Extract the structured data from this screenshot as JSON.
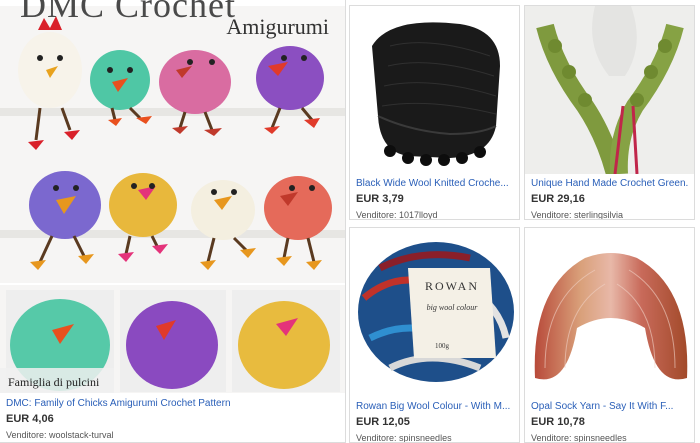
{
  "products": [
    {
      "title": "DMC: Family of Chicks Amigurumi Crochet Pattern",
      "price": "EUR 4,06",
      "seller": "Venditore: woolstack-turval",
      "image_texts": {
        "brand": "DMC Crochet",
        "subtitle": "Amigurumi",
        "caption": "Famiglia di pulcini"
      }
    },
    {
      "title": "Black Wide Wool Knitted Croche...",
      "price": "EUR 3,79",
      "seller": "Venditore: 1017lloyd"
    },
    {
      "title": "Unique Hand Made Crochet Green...",
      "price": "EUR 29,16",
      "seller": "Venditore: sterlingsilvia"
    },
    {
      "title": "Rowan Big Wool Colour - With M...",
      "price": "EUR 12,05",
      "seller": "Venditore: spinsneedles",
      "image_texts": {
        "brand": "ROWAN",
        "label": "big wool colour",
        "weight": "100g"
      }
    },
    {
      "title": "Opal Sock Yarn - Say It With F...",
      "price": "EUR 10,78",
      "seller": "Venditore: spinsneedles"
    }
  ],
  "colors": {
    "link": "#2a5fb8",
    "price": "#333333",
    "seller": "#555555",
    "border": "#dcdcdc"
  }
}
